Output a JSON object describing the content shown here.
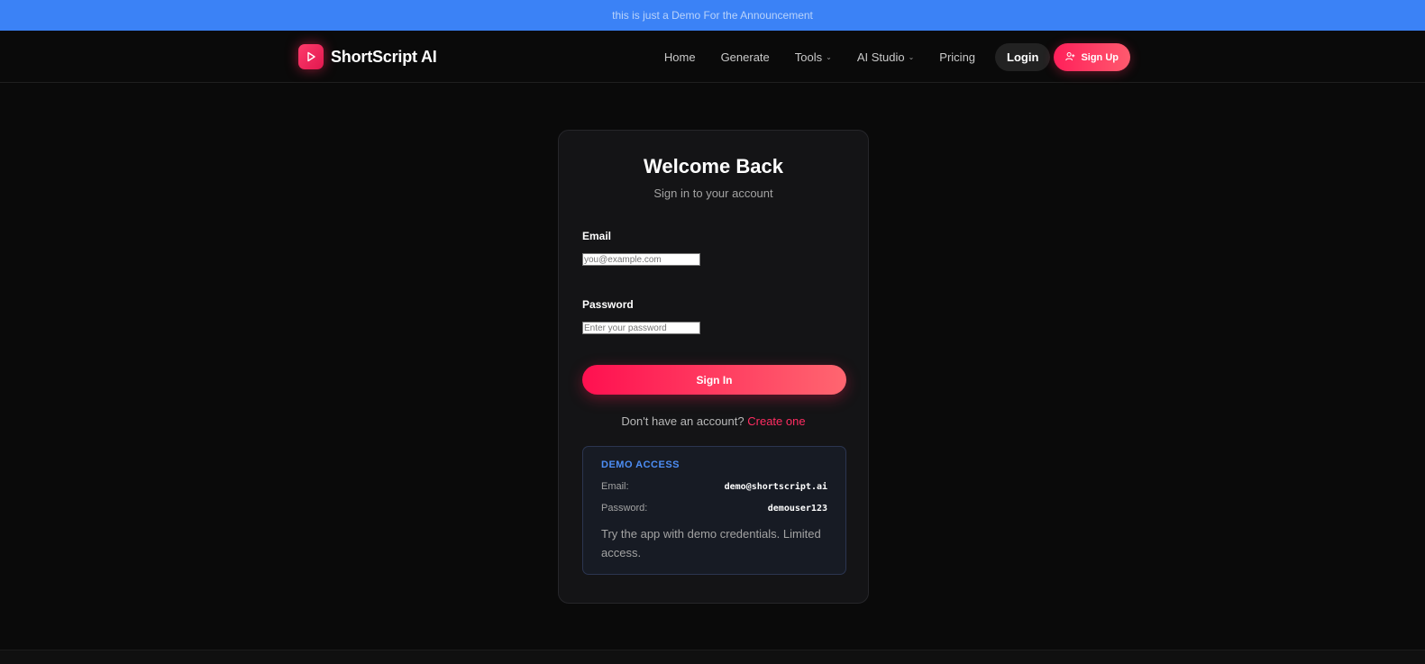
{
  "announcement": {
    "text": "this is just a Demo For the Announcement"
  },
  "brand": {
    "name": "ShortScript AI",
    "logo_icon": "play-icon",
    "accent": "#ff2d62"
  },
  "nav": {
    "links": [
      {
        "label": "Home"
      },
      {
        "label": "Generate"
      },
      {
        "label": "Tools",
        "has_dropdown": true
      },
      {
        "label": "AI Studio",
        "has_dropdown": true
      },
      {
        "label": "Pricing"
      }
    ],
    "login_label": "Login",
    "signup_label": "Sign Up",
    "signup_icon": "user-plus-icon"
  },
  "login_card": {
    "title": "Welcome Back",
    "subtitle": "Sign in to your account",
    "email_label": "Email",
    "email_placeholder": "you@example.com",
    "password_label": "Password",
    "password_placeholder": "Enter your password",
    "submit_label": "Sign In",
    "no_account_text": "Don't have an account?",
    "create_link": "Create one"
  },
  "demo": {
    "heading": "DEMO ACCESS",
    "email_label": "Email:",
    "email_value": "demo@shortscript.ai",
    "password_label": "Password:",
    "password_value": "demouser123",
    "note": "Try the app with demo credentials. Limited access."
  },
  "colors": {
    "announcement_bg": "#3b82f6",
    "page_bg": "#0a0a0a",
    "demo_heading": "#4d8ef5"
  }
}
